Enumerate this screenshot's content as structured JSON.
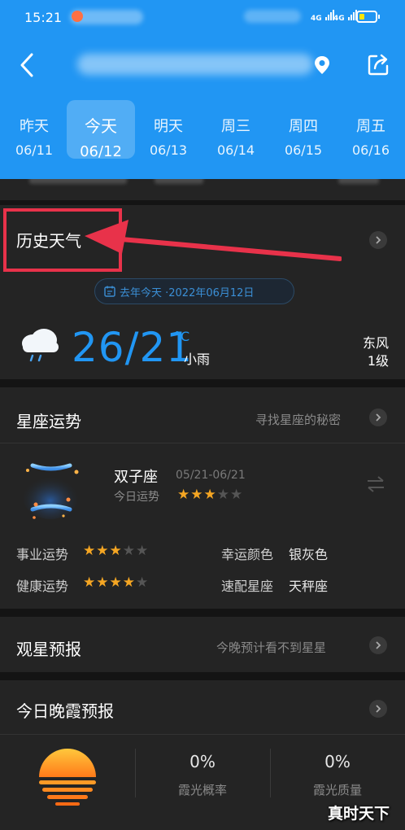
{
  "status_bar": {
    "time": "15:21",
    "signal1": "4G",
    "signal2": "4G"
  },
  "header": {
    "days": [
      {
        "name": "昨天",
        "date": "06/11"
      },
      {
        "name": "今天",
        "date": "06/12"
      },
      {
        "name": "明天",
        "date": "06/13"
      },
      {
        "name": "周三",
        "date": "06/14"
      },
      {
        "name": "周四",
        "date": "06/15"
      },
      {
        "name": "周五",
        "date": "06/16"
      }
    ],
    "active_day_index": 1,
    "accent": "#2196f3"
  },
  "history": {
    "title": "历史天气",
    "date_pill": "去年今天 ·2022年06月12日",
    "temperature": "26/21",
    "unit": "°C",
    "condition": "小雨",
    "wind_dir": "东风",
    "wind_level": "1级"
  },
  "astrology": {
    "title": "星座运势",
    "link": "寻找星座的秘密",
    "sign": "双子座",
    "range": "05/21-06/21",
    "today_label": "今日运势",
    "today_stars": 3,
    "rows": [
      {
        "label": "事业运势",
        "stars": 3
      },
      {
        "label": "健康运势",
        "stars": 4
      }
    ],
    "lucky_color_label": "幸运颜色",
    "lucky_color_value": "银灰色",
    "match_label": "速配星座",
    "match_value": "天秤座"
  },
  "stargazing": {
    "title": "观星预报",
    "text": "今晚预计看不到星星"
  },
  "sunset_glow": {
    "title": "今日晚霞预报",
    "probability_value": "0%",
    "probability_label": "霞光概率",
    "quality_value": "0%",
    "quality_label": "霞光质量"
  },
  "watermark": "真时天下"
}
